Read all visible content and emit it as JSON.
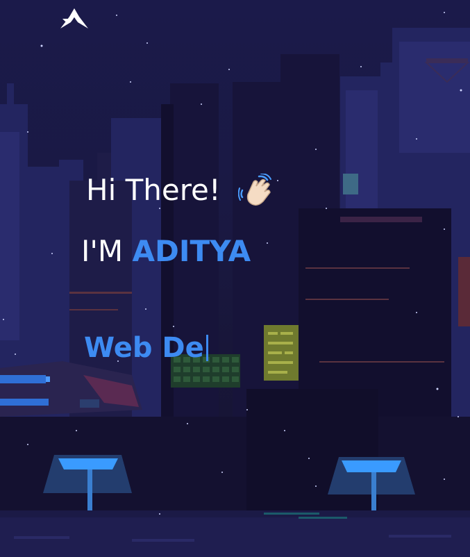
{
  "hero": {
    "greeting": "Hi There!",
    "intro_prefix": "I'M",
    "name": "ADITYA",
    "typed_text": "Web De"
  },
  "icons": {
    "logo": "logo-icon",
    "wave": "waving-hand-icon"
  },
  "colors": {
    "background": "#17163b",
    "accent": "#3d8bf2",
    "text": "#ffffff"
  }
}
